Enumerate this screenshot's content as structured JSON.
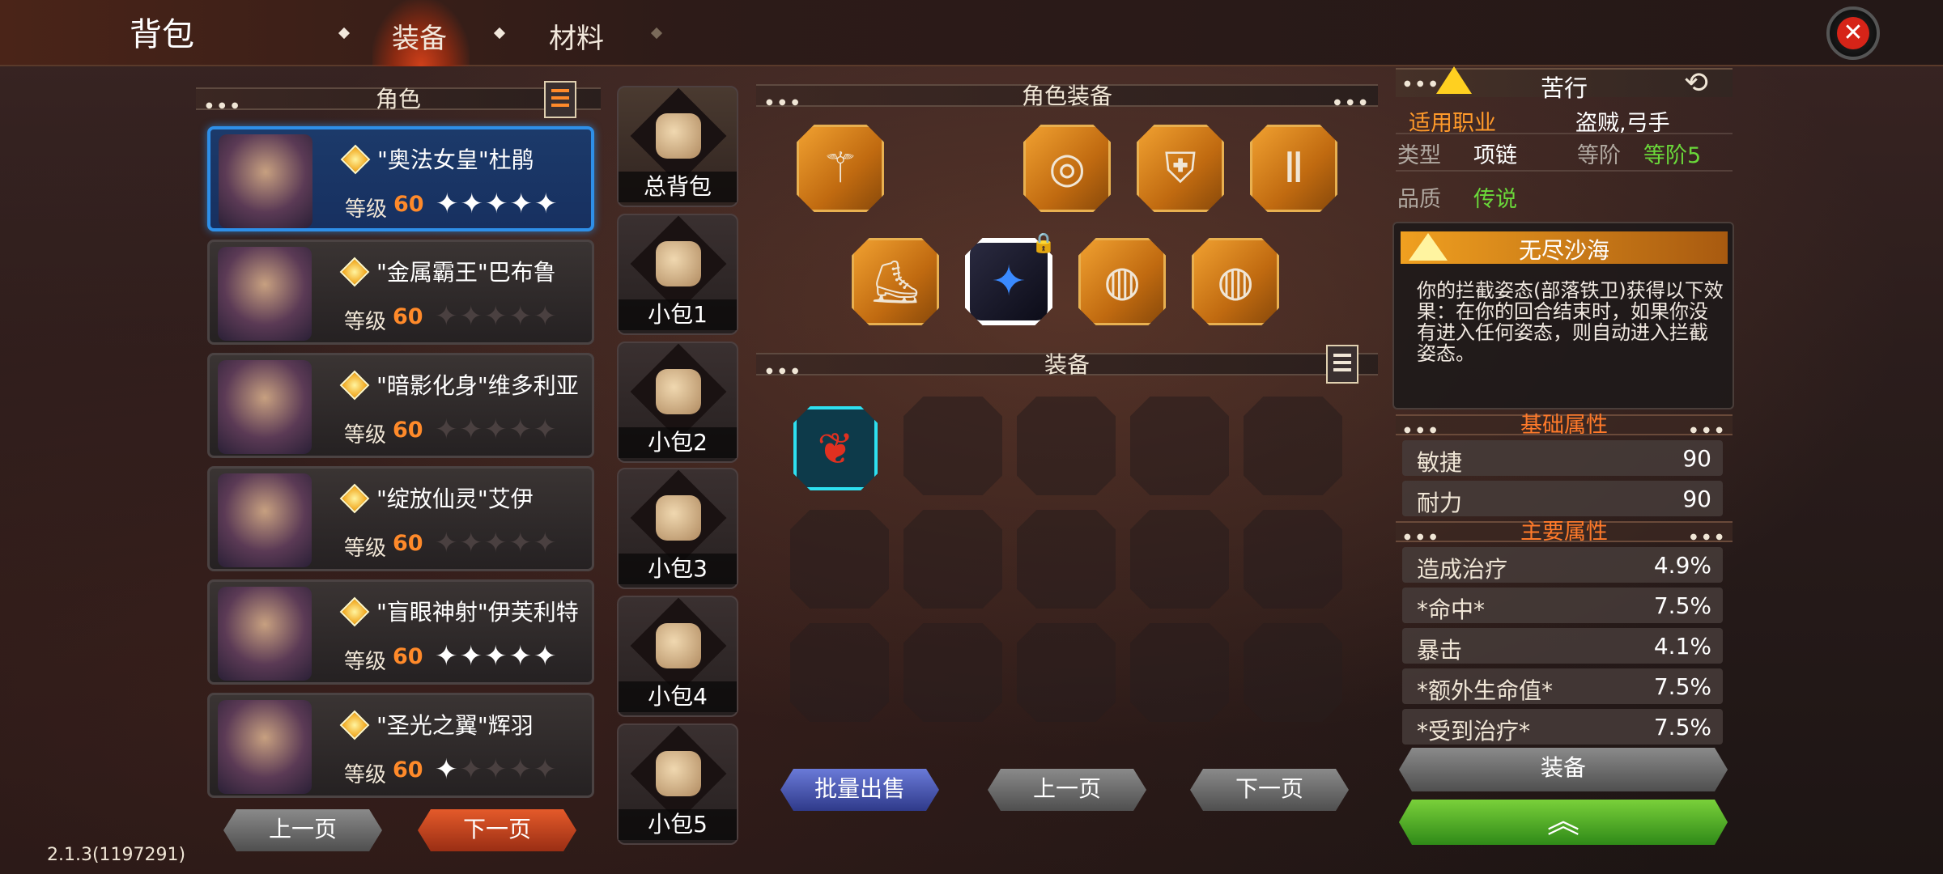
{
  "header": {
    "title": "背包",
    "tabs": [
      {
        "label": "装备",
        "active": true
      },
      {
        "label": "材料",
        "active": false
      }
    ]
  },
  "roles_panel": {
    "title": "角色",
    "characters": [
      {
        "name": "\"奥法女皇\"杜鹃",
        "level_label": "等级",
        "level": "60",
        "stars_filled": 5,
        "selected": true
      },
      {
        "name": "\"金属霸王\"巴布鲁",
        "level_label": "等级",
        "level": "60",
        "stars_filled": 0,
        "selected": false
      },
      {
        "name": "\"暗影化身\"维多利亚",
        "level_label": "等级",
        "level": "60",
        "stars_filled": 0,
        "selected": false
      },
      {
        "name": "\"绽放仙灵\"艾伊",
        "level_label": "等级",
        "level": "60",
        "stars_filled": 0,
        "selected": false
      },
      {
        "name": "\"盲眼神射\"伊芙利特",
        "level_label": "等级",
        "level": "60",
        "stars_filled": 5,
        "selected": false
      },
      {
        "name": "\"圣光之翼\"辉羽",
        "level_label": "等级",
        "level": "60",
        "stars_filled": 1,
        "selected": false
      }
    ],
    "prev_label": "上一页",
    "next_label": "下一页"
  },
  "bags": [
    {
      "label": "总背包",
      "active": true
    },
    {
      "label": "小包1",
      "active": false
    },
    {
      "label": "小包2",
      "active": false
    },
    {
      "label": "小包3",
      "active": false
    },
    {
      "label": "小包4",
      "active": false
    },
    {
      "label": "小包5",
      "active": false
    }
  ],
  "character_equipment": {
    "title": "角色装备",
    "row1": [
      {
        "icon": "staff-icon",
        "glyph": "⚚"
      },
      {
        "icon": "goggles-icon",
        "glyph": "◎"
      },
      {
        "icon": "armor-icon",
        "glyph": "⛨"
      },
      {
        "icon": "pants-icon",
        "glyph": "Ⅱ"
      }
    ],
    "row2": [
      {
        "icon": "boots-icon",
        "glyph": "⛸"
      },
      {
        "icon": "amulet-icon",
        "glyph": "✦",
        "selected": true,
        "locked": true
      },
      {
        "icon": "ring-icon",
        "glyph": "◍"
      },
      {
        "icon": "ring-icon",
        "glyph": "◍"
      }
    ]
  },
  "equipment_grid": {
    "title": "装备",
    "item_glyph": "❦",
    "sell_label": "批量出售",
    "prev_label": "上一页",
    "next_label": "下一页"
  },
  "detail": {
    "name": "苦行",
    "class_label": "适用职业",
    "class_value": "盗贼,弓手",
    "type_label": "类型",
    "type_value": "项链",
    "tier_label": "等阶",
    "tier_value": "等阶5",
    "quality_label": "品质",
    "quality_value": "传说",
    "effect_name": "无尽沙海",
    "effect_text": "你的拦截姿态(部落铁卫)获得以下效果：在你的回合结束时，如果你没有进入任何姿态，则自动进入拦截姿态。",
    "base_attr_title": "基础属性",
    "base_attrs": [
      {
        "name": "敏捷",
        "value": "90"
      },
      {
        "name": "耐力",
        "value": "90"
      }
    ],
    "main_attr_title": "主要属性",
    "main_attrs": [
      {
        "name": "造成治疗",
        "value": "4.9%"
      },
      {
        "name": "*命中*",
        "value": "7.5%"
      },
      {
        "name": "暴击",
        "value": "4.1%"
      },
      {
        "name": "*额外生命值*",
        "value": "7.5%"
      },
      {
        "name": "*受到治疗*",
        "value": "7.5%"
      }
    ],
    "equip_label": "装备",
    "upgrade_glyph": "︽"
  },
  "version": "2.1.3(1197291)",
  "colors": {
    "accent_orange": "#ff8a2a",
    "selected_blue": "#2e8fe8",
    "green": "#6ad83a",
    "cyan": "#2ee0f0"
  }
}
